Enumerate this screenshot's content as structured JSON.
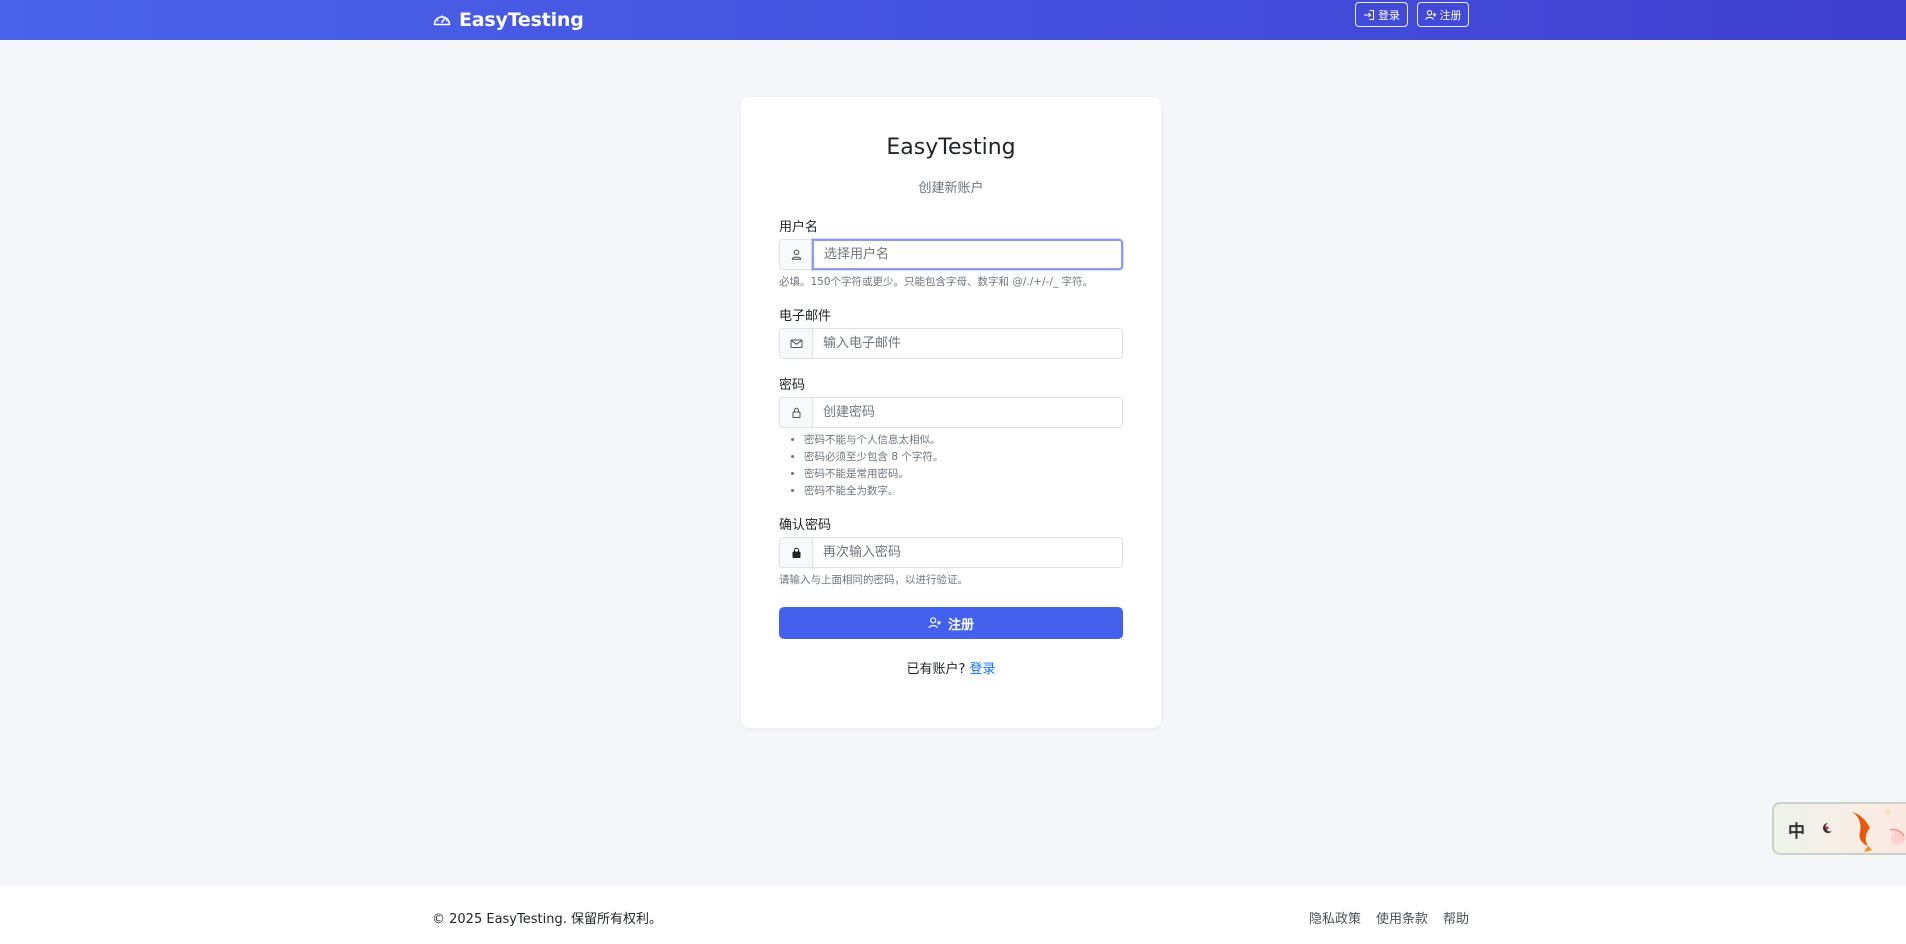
{
  "navbar": {
    "brand": "EasyTesting",
    "login_label": "登录",
    "register_label": "注册"
  },
  "card": {
    "title": "EasyTesting",
    "subtitle": "创建新账户",
    "username": {
      "label": "用户名",
      "placeholder": "选择用户名",
      "help": "必填。150个字符或更少。只能包含字母、数字和 @/./+/-/_ 字符。"
    },
    "email": {
      "label": "电子邮件",
      "placeholder": "输入电子邮件"
    },
    "password": {
      "label": "密码",
      "placeholder": "创建密码",
      "rules": [
        "密码不能与个人信息太相似。",
        "密码必须至少包含 8 个字符。",
        "密码不能是常用密码。",
        "密码不能全为数字。"
      ]
    },
    "confirm_password": {
      "label": "确认密码",
      "placeholder": "再次输入密码",
      "help": "请输入与上面相同的密码，以进行验证。"
    },
    "submit_label": "注册",
    "have_account_text": "已有账户?",
    "login_link": "登录"
  },
  "footer": {
    "copyright": "© 2025 EasyTesting. 保留所有权利。",
    "links": [
      "隐私政策",
      "使用条款",
      "帮助"
    ]
  },
  "widget": {
    "char": "中"
  },
  "colors": {
    "nav_start": "#4a63e8",
    "nav_end": "#3f3fcf",
    "primary": "#4361ee",
    "link": "#0d6efd"
  }
}
